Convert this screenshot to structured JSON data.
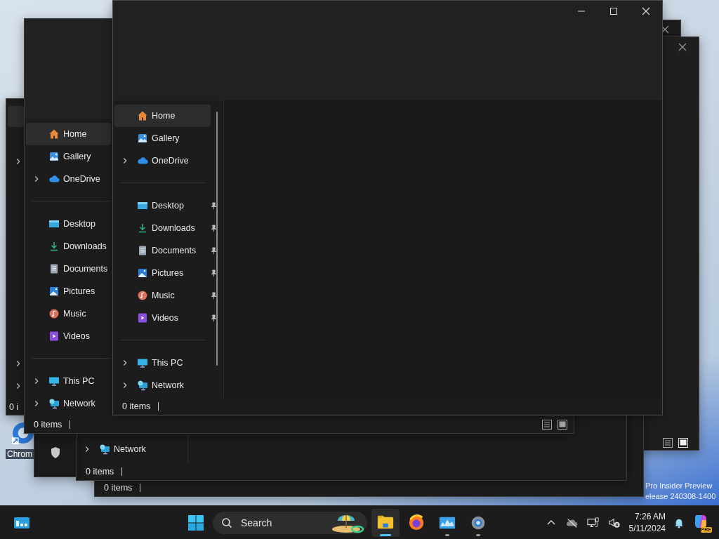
{
  "desktop": {
    "shortcut_label": "Chrom",
    "watermark_lines": [
      "Pro Insider Preview",
      "elease 240308-1400"
    ]
  },
  "left_window": {
    "status": "0 i"
  },
  "lower_window_front": {
    "nav_item": {
      "label": "Network",
      "expanded": false
    },
    "status": "0 items"
  },
  "lower_window_back": {
    "status": "0 items"
  },
  "explorer_windows": [
    {
      "nav_groups": [
        [
          {
            "label": "Home",
            "selected": true
          },
          {
            "label": "Gallery",
            "selected": false
          },
          {
            "label": "OneDrive",
            "selected": false,
            "expanded": false
          }
        ],
        [
          {
            "label": "Desktop",
            "selected": false
          },
          {
            "label": "Downloads",
            "selected": false
          },
          {
            "label": "Documents",
            "selected": false
          },
          {
            "label": "Pictures",
            "selected": false
          },
          {
            "label": "Music",
            "selected": false
          },
          {
            "label": "Videos",
            "selected": false
          }
        ],
        [
          {
            "label": "This PC",
            "selected": false,
            "expanded": false
          },
          {
            "label": "Network",
            "selected": false,
            "expanded": false
          }
        ]
      ],
      "status": "0 items"
    },
    {
      "nav_groups": [
        [
          {
            "label": "Home",
            "selected": true
          },
          {
            "label": "Gallery",
            "selected": false
          },
          {
            "label": "OneDrive",
            "selected": false,
            "expanded": false
          }
        ],
        [
          {
            "label": "Desktop",
            "selected": false,
            "pinned": true
          },
          {
            "label": "Downloads",
            "selected": false,
            "pinned": true
          },
          {
            "label": "Documents",
            "selected": false,
            "pinned": true
          },
          {
            "label": "Pictures",
            "selected": false,
            "pinned": true
          },
          {
            "label": "Music",
            "selected": false,
            "pinned": true
          },
          {
            "label": "Videos",
            "selected": false,
            "pinned": true
          }
        ],
        [
          {
            "label": "This PC",
            "selected": false,
            "expanded": false
          },
          {
            "label": "Network",
            "selected": false,
            "expanded": false
          }
        ]
      ],
      "status": "0 items"
    }
  ],
  "taskbar": {
    "search": {
      "placeholder": "Search"
    },
    "apps": [
      {
        "selected": true,
        "running": true
      },
      {
        "selected": false,
        "running": false
      },
      {
        "selected": false,
        "running": true
      },
      {
        "selected": false,
        "running": true
      }
    ],
    "time": "7:26 AM",
    "date": "5/11/2024",
    "copilot_badge": "PRE"
  }
}
